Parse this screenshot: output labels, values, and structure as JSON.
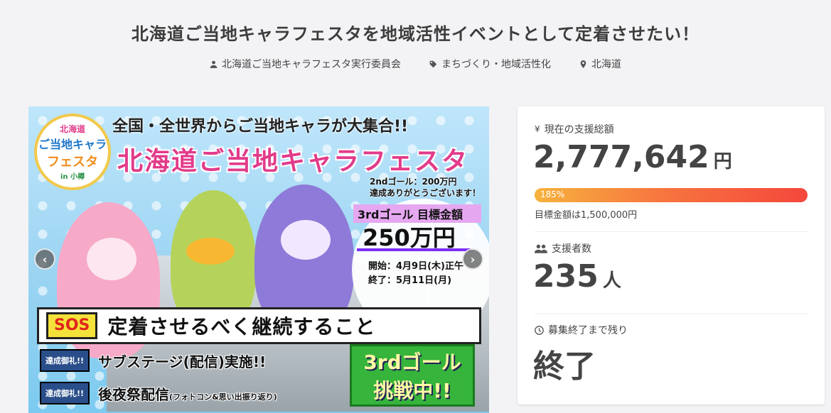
{
  "project": {
    "title": "北海道ご当地キャラフェスタを地域活性イベントとして定着させたい！",
    "owner": "北海道ご当地キャラフェスタ実行委員会",
    "category": "まちづくり・地域活性化",
    "location": "北海道"
  },
  "hero": {
    "headline": "全国・全世界からご当地キャラが大集合!!",
    "festival_name": "北海道ご当地キャラフェスタ",
    "logo": {
      "line1": "北海道",
      "line2": "ご当地キャラ",
      "line3": "フェスタ",
      "line4": "in 小樽"
    },
    "goal2_line1": "2ndゴール：200万円",
    "goal2_line2": "達成ありがとうございます！",
    "goal3_label": "3rdゴール 目標金額",
    "goal3_amount": "250万円",
    "start": "開始：4月9日(木)正午",
    "end": "終了：5月11日(月)",
    "sos": "SOS",
    "sos_text": "定着させるべく継続すること",
    "thanks_badge": "達成御礼!!",
    "thanks1": "サブステージ(配信)実施!!",
    "thanks2": "後夜祭配信",
    "thanks2_note": "(フォトコン&思い出振り返り)",
    "challenge1": "3rdゴール",
    "challenge2": "挑戦中!!",
    "prev": "‹",
    "next": "›"
  },
  "stats": {
    "raised_label": "現在の支援総額",
    "raised_value": "2,777,642",
    "raised_unit": "円",
    "progress_percent": 185,
    "progress_text": "185%",
    "target_text": "目標金額は1,500,000円",
    "supporters_label": "支援者数",
    "supporters_value": "235",
    "supporters_unit": "人",
    "remaining_label": "募集終了まで残り",
    "remaining_value": "終了"
  },
  "colors": {
    "accent_gradient_start": "#f6b33d",
    "accent_gradient_end": "#f4473c",
    "text": "#444444"
  },
  "icons": {
    "owner": "user-icon",
    "category": "tag-icon",
    "location": "pin-icon",
    "raised": "yen-icon",
    "supporters": "users-icon",
    "remaining": "clock-icon"
  }
}
